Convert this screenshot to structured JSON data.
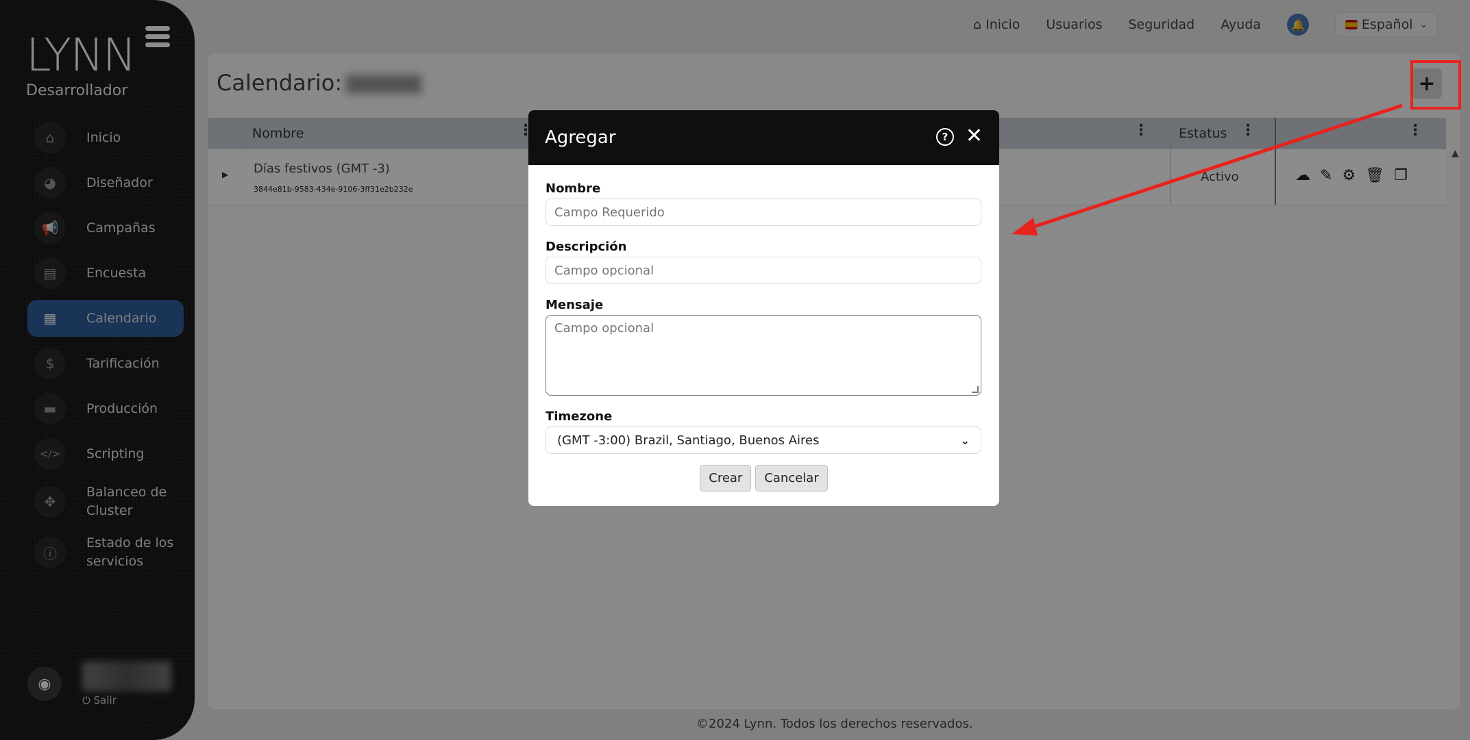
{
  "app": {
    "logo": "LYNN",
    "role": "Desarrollador"
  },
  "sidebar": {
    "items": [
      {
        "label": "Inicio",
        "icon": "home-icon",
        "glyph": "⌂"
      },
      {
        "label": "Diseñador",
        "icon": "palette-icon",
        "glyph": "◕"
      },
      {
        "label": "Campañas",
        "icon": "megaphone-icon",
        "glyph": "📢"
      },
      {
        "label": "Encuesta",
        "icon": "clipboard-icon",
        "glyph": "▤"
      },
      {
        "label": "Calendario",
        "icon": "calendar-icon",
        "glyph": "▦"
      },
      {
        "label": "Tarificación",
        "icon": "dollar-icon",
        "glyph": "$"
      },
      {
        "label": "Producción",
        "icon": "briefcase-icon",
        "glyph": "▬"
      },
      {
        "label": "Scripting",
        "icon": "code-icon",
        "glyph": "</>"
      },
      {
        "label": "Balanceo de Cluster",
        "icon": "cluster-icon",
        "glyph": "✥"
      },
      {
        "label": "Estado de los servicios",
        "icon": "info-icon",
        "glyph": "ⓘ"
      }
    ],
    "active": "Calendario",
    "logout": "Salir"
  },
  "topnav": {
    "items": [
      "Inicio",
      "Usuarios",
      "Seguridad",
      "Ayuda"
    ],
    "language": "Español"
  },
  "page": {
    "title": "Calendario:"
  },
  "table": {
    "headers": {
      "name": "Nombre",
      "status": "Estatus"
    },
    "rows": [
      {
        "name": "Días festivos (GMT -3)",
        "id": "3844e81b-9583-434e-9106-3ff31e2b232e",
        "status": "Activo"
      }
    ]
  },
  "modal": {
    "title": "Agregar",
    "fields": {
      "name_label": "Nombre",
      "name_placeholder": "Campo Requerido",
      "desc_label": "Descripción",
      "desc_placeholder": "Campo opcional",
      "msg_label": "Mensaje",
      "msg_placeholder": "Campo opcional",
      "tz_label": "Timezone",
      "tz_value": "(GMT -3:00) Brazil, Santiago, Buenos Aires"
    },
    "buttons": {
      "create": "Crear",
      "cancel": "Cancelar"
    }
  },
  "footer": {
    "text": "©2024 Lynn. Todos los derechos reservados."
  },
  "colors": {
    "accent": "#2f5f9e",
    "annotation": "#e8231f"
  }
}
